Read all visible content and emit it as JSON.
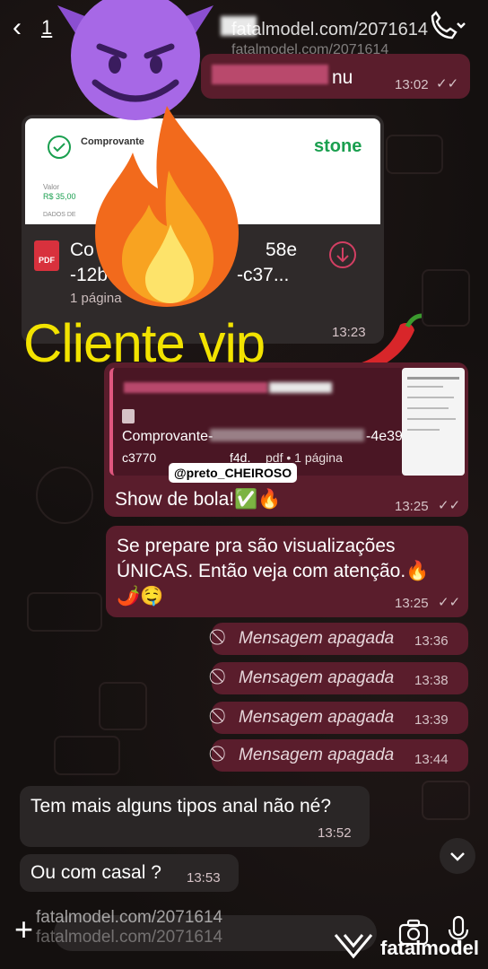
{
  "header": {
    "count": "1",
    "watermark": "fatalmodel.com/2071614",
    "watermark2": "fatalmodel.com/2071614"
  },
  "messages": {
    "m1": {
      "text": "nu",
      "time": "13:02"
    },
    "doc": {
      "preview_title": "Comprovante",
      "preview_value_label": "Valor",
      "preview_value": "R$ 35,00",
      "preview_section": "DADOS DE",
      "brand": "stone",
      "name_line1": "Co",
      "name_line1_end": "58e",
      "name_line2": "-12b",
      "name_line2_end": "-c37...",
      "pages": "1 página",
      "time": "13:23",
      "icon": "PDF"
    },
    "overlay": "Cliente vip",
    "reply_doc_pages": "pdf • 1 página",
    "reply_doc_name_a": "Comprovante-",
    "reply_doc_name_b": "c3770",
    "reply_doc_name_c": "f4d.",
    "reply_doc_name_d": "-4e39",
    "handle": "@preto_CHEIROSO",
    "m2": {
      "text": "Show de bola!✅🔥",
      "time": "13:25"
    },
    "m3": {
      "line1": "Se prepare pra são visualizações",
      "line2": "ÚNICAS. Então veja com atenção.🔥",
      "line3": "🌶️🤤",
      "time": "13:25"
    },
    "deleted": [
      {
        "text": "Mensagem apagada",
        "time": "13:36"
      },
      {
        "text": "Mensagem apagada",
        "time": "13:38"
      },
      {
        "text": "Mensagem apagada",
        "time": "13:39"
      },
      {
        "text": "Mensagem apagada",
        "time": "13:44"
      }
    ],
    "in1": {
      "text": "Tem mais alguns tipos anal não né?",
      "time": "13:52"
    },
    "in2": {
      "text": "Ou com casal ?",
      "time": "13:53"
    }
  },
  "footer": {
    "watermark": "fatalmodel.com/2071614",
    "watermark2": "fatalmodel.com/2071614",
    "brand": "fatalmodel",
    "plus": "+"
  },
  "colors": {
    "outgoing": "#5a1d2c",
    "incoming": "#2a2626",
    "overlay_text": "#f2e300"
  }
}
